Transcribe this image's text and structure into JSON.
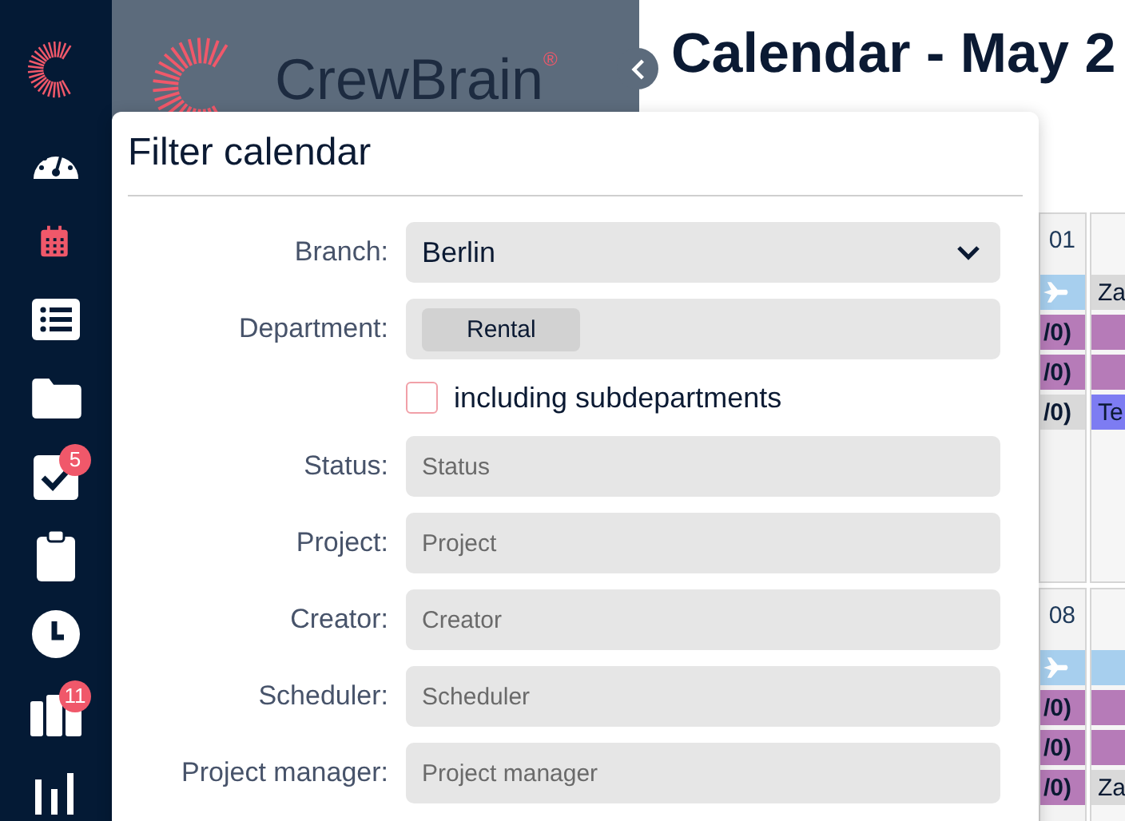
{
  "sidebar": {
    "items": [
      {
        "selected": false
      },
      {
        "selected": true
      },
      {
        "selected": false
      },
      {
        "selected": false
      },
      {
        "selected": false,
        "badge": "5"
      },
      {
        "selected": false
      },
      {
        "selected": false
      },
      {
        "selected": false,
        "badge": "11"
      },
      {
        "selected": false
      }
    ]
  },
  "banner": {
    "logo_text": "CrewBrain",
    "registered": "®"
  },
  "page_title": "Calendar - May 2",
  "calendar": {
    "weeks": [
      {
        "days": [
          {
            "date": "01",
            "events": [
              {
                "kind": "travel",
                "color": "#a7cfee"
              },
              {
                "kind": "text",
                "text": "/0)",
                "color": "#b67bb8"
              },
              {
                "kind": "text",
                "text": "/0)",
                "color": "#b67bb8"
              },
              {
                "kind": "text",
                "text": "/0)",
                "color": "#d9d9d9"
              }
            ]
          },
          {
            "events": [
              {
                "kind": "text",
                "text": "Za",
                "color": "#d9d9d9"
              },
              {
                "kind": "text",
                "color": "#b67bb8"
              },
              {
                "kind": "text",
                "color": "#b67bb8"
              },
              {
                "kind": "text",
                "text": "Te",
                "color": "#7d7cf2"
              }
            ]
          }
        ]
      },
      {
        "days": [
          {
            "date": "08",
            "events": [
              {
                "kind": "travel",
                "color": "#a7cfee"
              },
              {
                "kind": "text",
                "text": "/0)",
                "color": "#b67bb8"
              },
              {
                "kind": "text",
                "text": "/0)",
                "color": "#b67bb8"
              },
              {
                "kind": "text",
                "text": "/0)",
                "color": "#b67bb8"
              }
            ]
          },
          {
            "events": [
              {
                "kind": "text",
                "color": "#a7cfee"
              },
              {
                "kind": "text",
                "color": "#b67bb8"
              },
              {
                "kind": "text",
                "color": "#b67bb8"
              },
              {
                "kind": "text",
                "text": "Za",
                "color": "#d9d9d9"
              }
            ]
          }
        ]
      }
    ]
  },
  "filter": {
    "title": "Filter calendar",
    "fields": [
      {
        "kind": "select",
        "label": "Branch:",
        "value": "Berlin"
      },
      {
        "kind": "tags",
        "label": "Department:",
        "tags": [
          "Rental"
        ]
      },
      {
        "kind": "checkbox",
        "label": "including subdepartments",
        "checked": false
      },
      {
        "kind": "input",
        "label": "Status:",
        "placeholder": "Status"
      },
      {
        "kind": "input",
        "label": "Project:",
        "placeholder": "Project"
      },
      {
        "kind": "input",
        "label": "Creator:",
        "placeholder": "Creator"
      },
      {
        "kind": "input",
        "label": "Scheduler:",
        "placeholder": "Scheduler"
      },
      {
        "kind": "input",
        "label": "Project manager:",
        "placeholder": "Project manager"
      }
    ]
  }
}
